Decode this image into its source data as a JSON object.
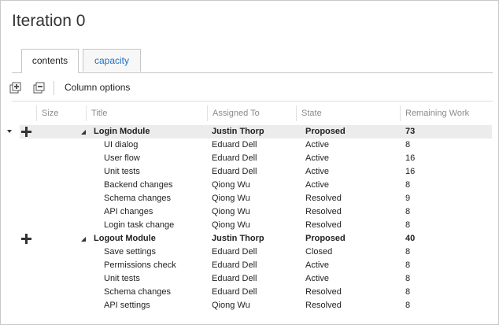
{
  "page": {
    "title": "Iteration 0"
  },
  "tabs": [
    {
      "label": "contents",
      "active": true
    },
    {
      "label": "capacity",
      "active": false
    }
  ],
  "toolbar": {
    "expand_icon": "expand-all-icon",
    "collapse_icon": "collapse-all-icon",
    "column_options_label": "Column options"
  },
  "grid": {
    "columns": [
      "Size",
      "Title",
      "Assigned To",
      "State",
      "Remaining Work"
    ],
    "rows": [
      {
        "title": "Login Module",
        "assigned": "Justin Thorp",
        "state": "Proposed",
        "remaining": "73"
      },
      {
        "title": "UI dialog",
        "assigned": "Eduard Dell",
        "state": "Active",
        "remaining": "8"
      },
      {
        "title": "User flow",
        "assigned": "Eduard Dell",
        "state": "Active",
        "remaining": "16"
      },
      {
        "title": "Unit tests",
        "assigned": "Eduard Dell",
        "state": "Active",
        "remaining": "16"
      },
      {
        "title": "Backend changes",
        "assigned": "Qiong Wu",
        "state": "Active",
        "remaining": "8"
      },
      {
        "title": "Schema changes",
        "assigned": "Qiong Wu",
        "state": "Resolved",
        "remaining": "9"
      },
      {
        "title": "API changes",
        "assigned": "Qiong Wu",
        "state": "Resolved",
        "remaining": "8"
      },
      {
        "title": "Login task change",
        "assigned": "Qiong Wu",
        "state": "Resolved",
        "remaining": "8"
      },
      {
        "title": "Logout Module",
        "assigned": "Justin Thorp",
        "state": "Proposed",
        "remaining": "40"
      },
      {
        "title": "Save settings",
        "assigned": "Eduard Dell",
        "state": "Closed",
        "remaining": "8"
      },
      {
        "title": "Permissions check",
        "assigned": "Eduard Dell",
        "state": "Active",
        "remaining": "8"
      },
      {
        "title": "Unit tests",
        "assigned": "Eduard Dell",
        "state": "Active",
        "remaining": "8"
      },
      {
        "title": "Schema changes",
        "assigned": "Eduard Dell",
        "state": "Resolved",
        "remaining": "8"
      },
      {
        "title": "API settings",
        "assigned": "Qiong Wu",
        "state": "Resolved",
        "remaining": "8"
      }
    ]
  }
}
